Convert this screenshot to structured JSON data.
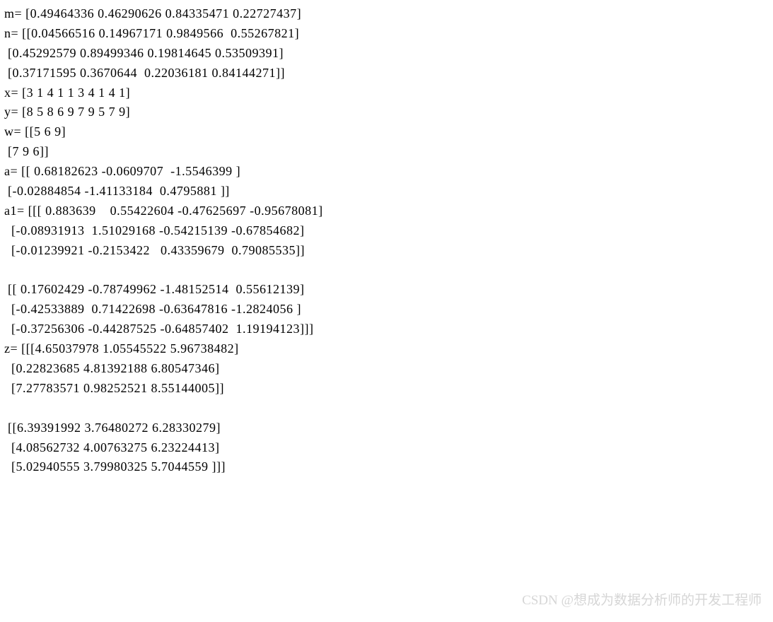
{
  "lines": [
    "m= [0.49464336 0.46290626 0.84335471 0.22727437]",
    "n= [[0.04566516 0.14967171 0.9849566  0.55267821]",
    " [0.45292579 0.89499346 0.19814645 0.53509391]",
    " [0.37171595 0.3670644  0.22036181 0.84144271]]",
    "x= [3 1 4 1 1 3 4 1 4 1]",
    "y= [8 5 8 6 9 7 9 5 7 9]",
    "w= [[5 6 9]",
    " [7 9 6]]",
    "a= [[ 0.68182623 -0.0609707  -1.5546399 ]",
    " [-0.02884854 -1.41133184  0.4795881 ]]",
    "a1= [[[ 0.883639    0.55422604 -0.47625697 -0.95678081]",
    "  [-0.08931913  1.51029168 -0.54215139 -0.67854682]",
    "  [-0.01239921 -0.2153422   0.43359679  0.79085535]]",
    "",
    " [[ 0.17602429 -0.78749962 -1.48152514  0.55612139]",
    "  [-0.42533889  0.71422698 -0.63647816 -1.2824056 ]",
    "  [-0.37256306 -0.44287525 -0.64857402  1.19194123]]]",
    "z= [[[4.65037978 1.05545522 5.96738482]",
    "  [0.22823685 4.81392188 6.80547346]",
    "  [7.27783571 0.98252521 8.55144005]]",
    "",
    " [[6.39391992 3.76480272 6.28330279]",
    "  [4.08562732 4.00763275 6.23224413]",
    "  [5.02940555 3.79980325 5.7044559 ]]]"
  ],
  "watermark": "CSDN @想成为数据分析师的开发工程师"
}
